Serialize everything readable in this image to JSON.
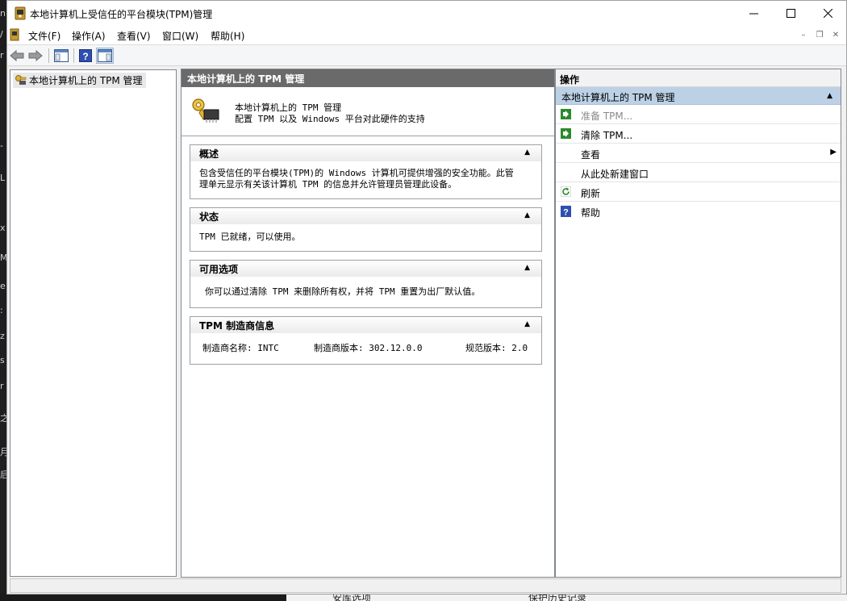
{
  "window": {
    "title": "本地计算机上受信任的平台模块(TPM)管理"
  },
  "menu": {
    "items": [
      "文件(F)",
      "操作(A)",
      "查看(V)",
      "窗口(W)",
      "帮助(H)"
    ]
  },
  "tree": {
    "root": "本地计算机上的 TPM 管理"
  },
  "center": {
    "header": "本地计算机上的 TPM 管理",
    "intro_title": "本地计算机上的 TPM 管理",
    "intro_desc": "配置 TPM 以及 Windows 平台对此硬件的支持",
    "sections": {
      "overview": {
        "title": "概述",
        "body_line1": "包含受信任的平台模块(TPM)的 Windows 计算机可提供增强的安全功能。此管",
        "body_line2": "理单元显示有关该计算机 TPM 的信息并允许管理员管理此设备。"
      },
      "status": {
        "title": "状态",
        "body": "TPM 已就绪，可以使用。"
      },
      "options": {
        "title": "可用选项",
        "body": "你可以通过清除 TPM 来删除所有权，并将 TPM 重置为出厂默认值。"
      },
      "manufacturer": {
        "title": "TPM 制造商信息",
        "name": "制造商名称: INTC",
        "version": "制造商版本: 302.12.0.0",
        "spec": "规范版本: 2.0"
      }
    }
  },
  "actions": {
    "header": "操作",
    "section": "本地计算机上的 TPM 管理",
    "items": [
      "准备 TPM...",
      "清除 TPM...",
      "查看",
      "从此处新建窗口",
      "刷新",
      "帮助"
    ]
  },
  "background": {
    "bottom_text_1": "安库选项",
    "bottom_text_2": "保护历史记录"
  },
  "colors": {
    "center_header_bg": "#6a6a6a",
    "action_section_bg": "#bcd1e6",
    "action_icon_green": "#2b8a2b",
    "help_icon_blue": "#2f4fb0"
  }
}
